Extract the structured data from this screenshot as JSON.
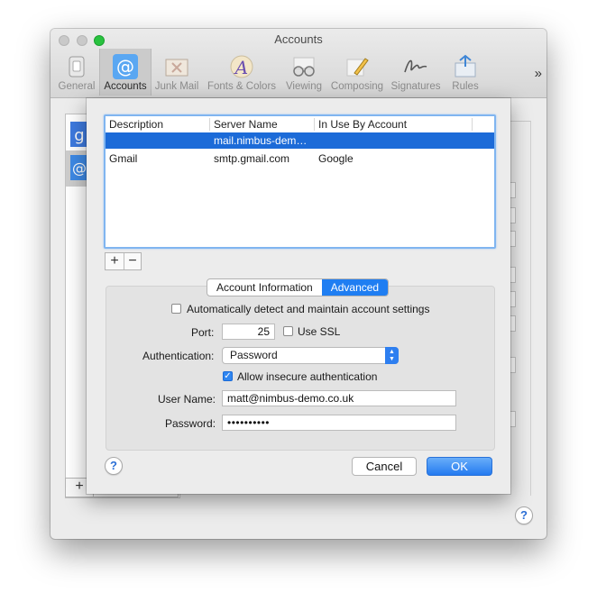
{
  "window": {
    "title": "Accounts"
  },
  "toolbar": {
    "items": [
      {
        "label": "General",
        "icon": "general-switch-icon"
      },
      {
        "label": "Accounts",
        "icon": "at-sign-icon"
      },
      {
        "label": "Junk Mail",
        "icon": "junk-mail-icon"
      },
      {
        "label": "Fonts & Colors",
        "icon": "fonts-colors-icon"
      },
      {
        "label": "Viewing",
        "icon": "glasses-icon"
      },
      {
        "label": "Composing",
        "icon": "pencil-icon"
      },
      {
        "label": "Signatures",
        "icon": "signature-icon"
      },
      {
        "label": "Rules",
        "icon": "rules-icon"
      }
    ],
    "selected": "Accounts",
    "overflow_label": "»"
  },
  "smtp_table": {
    "columns": [
      "Description",
      "Server Name",
      "In Use By Account"
    ],
    "rows": [
      {
        "description": "",
        "server": "mail.nimbus-dem…",
        "account": "",
        "selected": true
      },
      {
        "description": "Gmail",
        "server": "smtp.gmail.com",
        "account": "Google",
        "selected": false
      }
    ],
    "add_label": "+",
    "remove_label": "−"
  },
  "tabs": {
    "items": [
      "Account Information",
      "Advanced"
    ],
    "active": "Advanced"
  },
  "advanced": {
    "auto_detect_label": "Automatically detect and maintain account settings",
    "auto_detect_checked": false,
    "port_label": "Port:",
    "port_value": "25",
    "use_ssl_label": "Use SSL",
    "use_ssl_checked": false,
    "auth_label": "Authentication:",
    "auth_value": "Password",
    "allow_insecure_label": "Allow insecure authentication",
    "allow_insecure_checked": true,
    "username_label": "User Name:",
    "username_value": "matt@nimbus-demo.co.uk",
    "password_label": "Password:",
    "password_value": "••••••••••"
  },
  "sheet_buttons": {
    "help": "?",
    "cancel": "Cancel",
    "ok": "OK"
  },
  "background": {
    "add_label": "+",
    "help": "?"
  },
  "colors": {
    "accent": "#1f7ef2",
    "selection": "#1c6bd8",
    "zoom_button": "#29c23f"
  }
}
